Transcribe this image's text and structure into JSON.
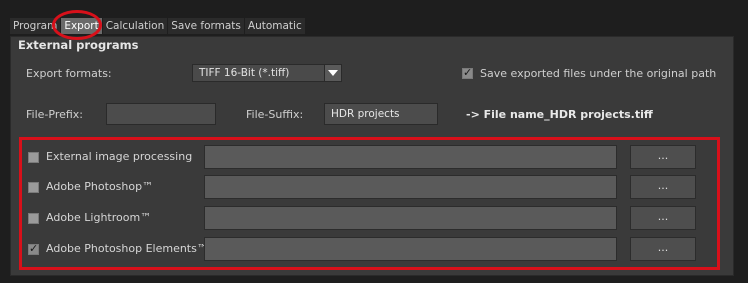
{
  "tabs": [
    {
      "label": "Program"
    },
    {
      "label": "Export"
    },
    {
      "label": "Calculation"
    },
    {
      "label": "Save formats"
    },
    {
      "label": "Automatic"
    }
  ],
  "section": {
    "title": "External programs"
  },
  "export": {
    "formats_label": "Export formats:",
    "format_value": "TIFF 16-Bit (*.tiff)",
    "save_original_label": "Save exported files under the original path",
    "prefix_label": "File-Prefix:",
    "prefix_value": "",
    "suffix_label": "File-Suffix:",
    "suffix_value": "HDR projects",
    "preview": "-> File name_HDR projects.tiff"
  },
  "programs": [
    {
      "label": "External image processing",
      "checked": false,
      "button": "..."
    },
    {
      "label": "Adobe Photoshop™",
      "checked": false,
      "button": "..."
    },
    {
      "label": "Adobe Lightroom™",
      "checked": false,
      "button": "..."
    },
    {
      "label": "Adobe Photoshop Elements™",
      "checked": true,
      "button": "..."
    }
  ],
  "colors": {
    "highlight": "#d8101a",
    "background": "#1e1e1e",
    "panel": "#3a3a3a"
  }
}
